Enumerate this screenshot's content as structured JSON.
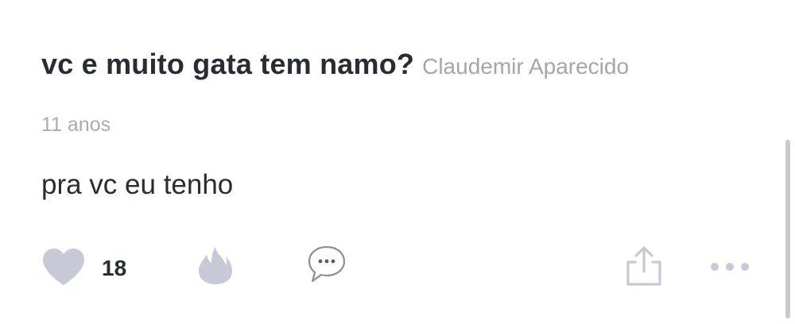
{
  "post": {
    "question": "vc e muito gata tem namo?",
    "author": "Claudemir Aparecido",
    "time_ago": "11 anos",
    "answer": "pra vc eu tenho",
    "like_count": "18"
  },
  "icons": {
    "like": "heart-icon",
    "fire": "fire-icon",
    "comment": "speech-bubble-icon",
    "share": "share-icon",
    "more": "more-dots-icon"
  },
  "colors": {
    "text": "#2a2c33",
    "muted": "#a9abb2",
    "icon": "#c8c9d6"
  }
}
